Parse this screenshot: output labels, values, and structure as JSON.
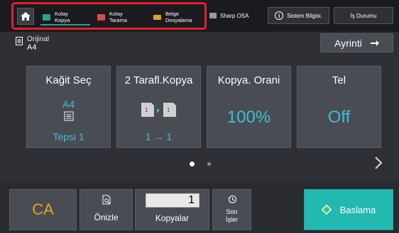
{
  "topbar": {
    "shortcuts": [
      {
        "label": "Kolay\nKopya",
        "icon": "easy-copy-icon",
        "color": "#27a77d"
      },
      {
        "label": "Kolay\nTarama",
        "icon": "easy-scan-icon",
        "color": "#e0474c"
      },
      {
        "label": "Belge\nDosyalama",
        "icon": "folder-icon",
        "color": "#e0a22a"
      }
    ],
    "sharp_osa": {
      "label": "Sharp OSA",
      "icon": "sharp-osa-icon"
    },
    "system_info": {
      "label": "Sistem Bilgisi.",
      "icon": "info-icon"
    },
    "job_status": {
      "label": "İş Durumu"
    }
  },
  "original": {
    "label": "Orijinal",
    "value": "A4",
    "icon": "document-icon"
  },
  "detail_button": {
    "label": "Ayrinti",
    "icon": "arrow-right-icon"
  },
  "cards": {
    "paper": {
      "title": "Kağit Seç",
      "size": "A4",
      "tray": "Tepsi 1",
      "icon": "paper-tray-icon"
    },
    "duplex": {
      "title": "2 Tarafl.Kopya",
      "mode": "1 → 1",
      "icon": "duplex-copy-icon"
    },
    "ratio": {
      "title": "Kopya. Orani",
      "value": "100%"
    },
    "staple": {
      "title": "Tel",
      "value": "Off"
    }
  },
  "pager": {
    "pages": 2,
    "current": 1
  },
  "bottom": {
    "ca": {
      "label": "CA"
    },
    "preview": {
      "label": "Önizle",
      "icon": "preview-icon"
    },
    "copies": {
      "value": "1",
      "label": "Kopyalar"
    },
    "recent": {
      "label": "Son\nİşler",
      "icon": "history-icon"
    },
    "start": {
      "label": "Baslama",
      "icon": "start-diamond-icon"
    }
  },
  "colors": {
    "accent": "#3dbfd6",
    "start": "#22b9b1",
    "ca": "#e3a31d",
    "highlight": "#e4202a"
  }
}
